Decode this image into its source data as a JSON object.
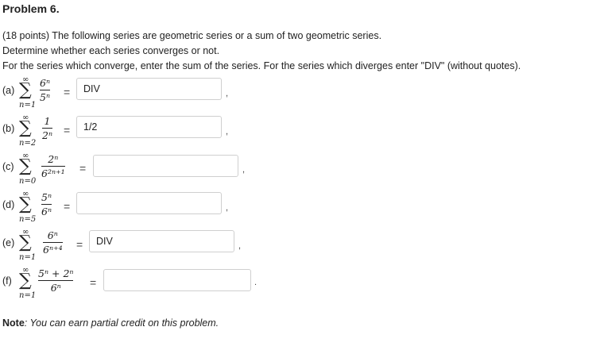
{
  "problem": {
    "title": "Problem 6.",
    "intro": "(18 points) The following series are geometric series or a sum of two geometric series.",
    "line2": "Determine whether each series converges or not.",
    "line3": "For the series which converge, enter the sum of the series. For the series which diverges enter \"DIV\" (without quotes)."
  },
  "parts": [
    {
      "label": "(a)",
      "upper": "∞",
      "lower": "n=1",
      "num": "6ⁿ",
      "den": "5ⁿ",
      "answer": "DIV",
      "punct": ","
    },
    {
      "label": "(b)",
      "upper": "∞",
      "lower": "n=2",
      "num": "1",
      "den": "2ⁿ",
      "answer": "1/2",
      "punct": ","
    },
    {
      "label": "(c)",
      "upper": "∞",
      "lower": "n=0",
      "num": "2ⁿ",
      "den": "6²ⁿ⁺¹",
      "answer": "",
      "punct": ","
    },
    {
      "label": "(d)",
      "upper": "∞",
      "lower": "n=5",
      "num": "5ⁿ",
      "den": "6ⁿ",
      "answer": "",
      "punct": ","
    },
    {
      "label": "(e)",
      "upper": "∞",
      "lower": "n=1",
      "num": "6ⁿ",
      "den": "6ⁿ⁺⁴",
      "answer": "DIV",
      "punct": ","
    },
    {
      "label": "(f)",
      "upper": "∞",
      "lower": "n=1",
      "num": "5ⁿ + 2ⁿ",
      "den": "6ⁿ",
      "answer": "",
      "punct": "."
    }
  ],
  "symbols": {
    "sigma": "∑",
    "equals": "="
  },
  "note": {
    "label": "Note",
    "text": ": You can earn partial credit on this problem."
  }
}
